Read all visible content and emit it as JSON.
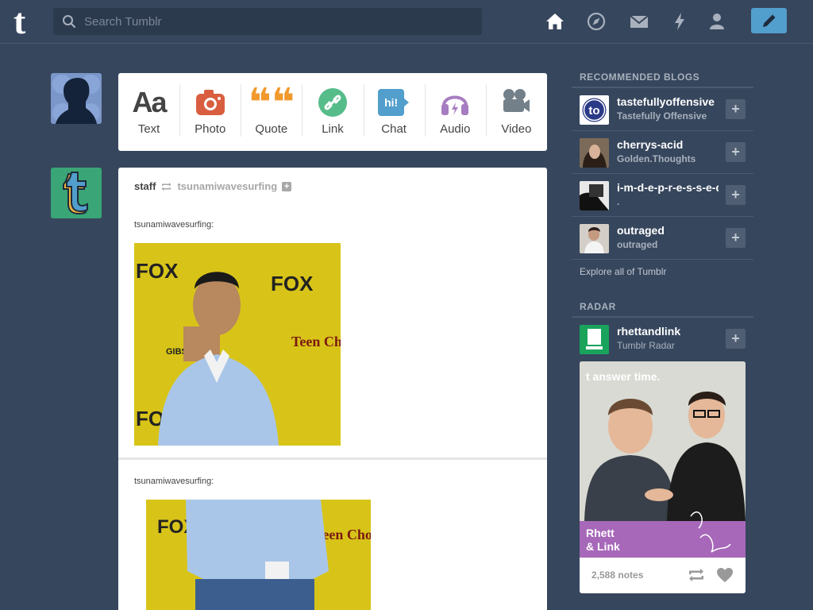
{
  "header": {
    "search_placeholder": "Search Tumblr",
    "logo_letter": "t",
    "nav": [
      "home-icon",
      "explore-icon",
      "inbox-icon",
      "activity-icon",
      "account-icon"
    ],
    "compose": "pencil-icon"
  },
  "post_types": [
    {
      "label": "Text",
      "glyph": "Aa",
      "color": "#444444"
    },
    {
      "label": "Photo",
      "icon": "camera-icon",
      "color": "#d95e40"
    },
    {
      "label": "Quote",
      "glyph": "❝❝",
      "color": "#f2992e"
    },
    {
      "label": "Link",
      "icon": "link-icon",
      "color": "#56bc8a"
    },
    {
      "label": "Chat",
      "glyph": "hi!",
      "color": "#529ecc"
    },
    {
      "label": "Audio",
      "icon": "headphones-icon",
      "color": "#a77dc2"
    },
    {
      "label": "Video",
      "icon": "video-camera-icon",
      "color": "#748089"
    }
  ],
  "post": {
    "author": "staff",
    "reblogged_from": "tsunamiwavesurfing",
    "quote_user_1": "tsunamiwavesurfing:",
    "quote_user_2": "tsunamiwavesurfing:",
    "photo_text": [
      "FOX",
      "FOX",
      "FOX",
      "Teen Choice Awards",
      "GIBSON"
    ]
  },
  "sidebar": {
    "recommended_title": "RECOMMENDED BLOGS",
    "blogs": [
      {
        "name": "tastefullyoffensive",
        "sub": "Tastefully Offensive",
        "badge": "to"
      },
      {
        "name": "cherrys-acid",
        "sub": "Golden.Thoughts"
      },
      {
        "name": "i-m-d-e-p-r-e-s-s-e-d",
        "sub": "."
      },
      {
        "name": "outraged",
        "sub": "outraged"
      }
    ],
    "explore": "Explore all of Tumblr",
    "radar_title": "RADAR",
    "radar": {
      "name": "rhettandlink",
      "sub": "Tumblr Radar",
      "image_caption_top": "t answer time.",
      "image_caption_bottom_1": "Rhett",
      "image_caption_bottom_2": "& Link",
      "notes": "2,588 notes"
    }
  }
}
